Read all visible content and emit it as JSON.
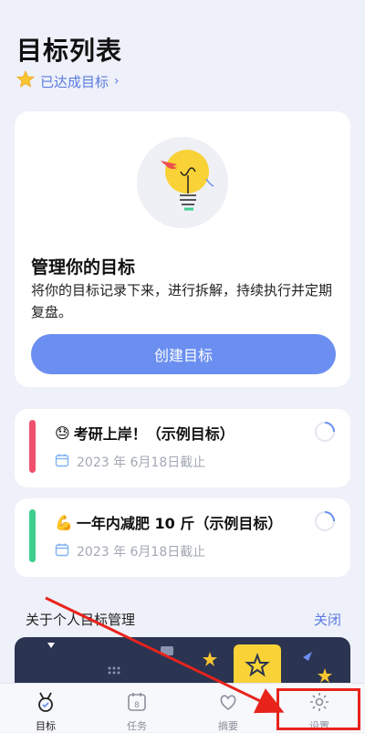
{
  "header": {
    "title": "目标列表",
    "achieved_link": "已达成目标"
  },
  "intro": {
    "title": "管理你的目标",
    "description": "将你的目标记录下来，进行拆解，持续执行并定期复盘。",
    "create_button": "创建目标"
  },
  "goals": [
    {
      "emoji": "😓",
      "title": "考研上岸！（示例目标）",
      "deadline": "2023 年 6月18日截止",
      "color": "#f0506e"
    },
    {
      "emoji": "💪",
      "title": "一年内减肥 10 斤（示例目标）",
      "deadline": "2023 年 6月18日截止",
      "color": "#3ecf8e"
    }
  ],
  "about": {
    "title": "关于个人目标管理",
    "close": "关闭"
  },
  "tabs": [
    {
      "label": "目标",
      "active": true
    },
    {
      "label": "任务",
      "active": false
    },
    {
      "label": "摘要",
      "active": false
    },
    {
      "label": "设置",
      "active": false
    }
  ],
  "tab_icons": {
    "task_badge": "8"
  },
  "colors": {
    "accent": "#6b8ff0",
    "link": "#5b7be0",
    "annotation": "#e8231c"
  }
}
